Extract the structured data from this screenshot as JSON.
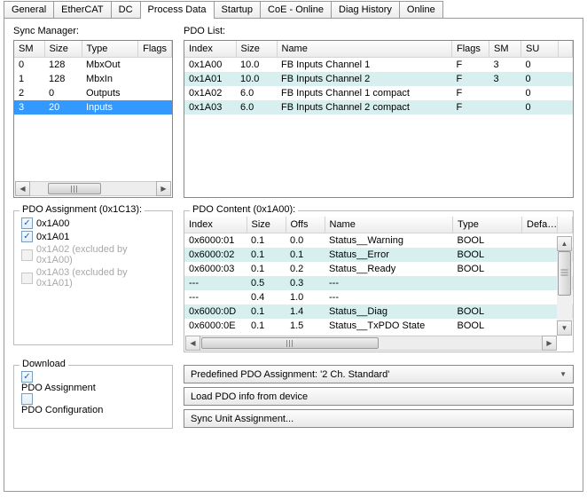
{
  "tabs": [
    "General",
    "EtherCAT",
    "DC",
    "Process Data",
    "Startup",
    "CoE - Online",
    "Diag History",
    "Online"
  ],
  "active_tab": 3,
  "sync_manager": {
    "label": "Sync Manager:",
    "headers": [
      "SM",
      "Size",
      "Type",
      "Flags"
    ],
    "rows": [
      {
        "sm": "0",
        "size": "128",
        "type": "MbxOut",
        "flags": ""
      },
      {
        "sm": "1",
        "size": "128",
        "type": "MbxIn",
        "flags": ""
      },
      {
        "sm": "2",
        "size": "0",
        "type": "Outputs",
        "flags": ""
      },
      {
        "sm": "3",
        "size": "20",
        "type": "Inputs",
        "flags": ""
      }
    ],
    "selected": 3
  },
  "pdo_list": {
    "label": "PDO List:",
    "headers": [
      "Index",
      "Size",
      "Name",
      "Flags",
      "SM",
      "SU"
    ],
    "rows": [
      {
        "index": "0x1A00",
        "size": "10.0",
        "name": "FB Inputs Channel 1",
        "flags": "F",
        "sm": "3",
        "su": "0"
      },
      {
        "index": "0x1A01",
        "size": "10.0",
        "name": "FB Inputs Channel 2",
        "flags": "F",
        "sm": "3",
        "su": "0"
      },
      {
        "index": "0x1A02",
        "size": "6.0",
        "name": "FB Inputs Channel 1 compact",
        "flags": "F",
        "sm": "",
        "su": "0"
      },
      {
        "index": "0x1A03",
        "size": "6.0",
        "name": "FB Inputs Channel 2 compact",
        "flags": "F",
        "sm": "",
        "su": "0"
      }
    ]
  },
  "pdo_assignment": {
    "label": "PDO Assignment (0x1C13):",
    "items": [
      {
        "label": "0x1A00",
        "checked": true,
        "disabled": false
      },
      {
        "label": "0x1A01",
        "checked": true,
        "disabled": false
      },
      {
        "label": "0x1A02 (excluded by 0x1A00)",
        "checked": false,
        "disabled": true
      },
      {
        "label": "0x1A03 (excluded by 0x1A01)",
        "checked": false,
        "disabled": true
      }
    ]
  },
  "pdo_content": {
    "label": "PDO Content (0x1A00):",
    "headers": [
      "Index",
      "Size",
      "Offs",
      "Name",
      "Type",
      "Default"
    ],
    "header_defa": "Defa…",
    "rows": [
      {
        "index": "0x6000:01",
        "size": "0.1",
        "offs": "0.0",
        "name": "Status__Warning",
        "type": "BOOL"
      },
      {
        "index": "0x6000:02",
        "size": "0.1",
        "offs": "0.1",
        "name": "Status__Error",
        "type": "BOOL"
      },
      {
        "index": "0x6000:03",
        "size": "0.1",
        "offs": "0.2",
        "name": "Status__Ready",
        "type": "BOOL"
      },
      {
        "index": "---",
        "size": "0.5",
        "offs": "0.3",
        "name": "---",
        "type": ""
      },
      {
        "index": "---",
        "size": "0.4",
        "offs": "1.0",
        "name": "---",
        "type": ""
      },
      {
        "index": "0x6000:0D",
        "size": "0.1",
        "offs": "1.4",
        "name": "Status__Diag",
        "type": "BOOL"
      },
      {
        "index": "0x6000:0E",
        "size": "0.1",
        "offs": "1.5",
        "name": "Status__TxPDO State",
        "type": "BOOL"
      }
    ]
  },
  "download": {
    "label": "Download",
    "items": [
      {
        "label": "PDO Assignment",
        "checked": true
      },
      {
        "label": "PDO Configuration",
        "checked": false
      }
    ]
  },
  "buttons": {
    "predefined": "Predefined PDO Assignment: '2 Ch. Standard'",
    "load": "Load PDO info from device",
    "sync": "Sync Unit Assignment..."
  }
}
